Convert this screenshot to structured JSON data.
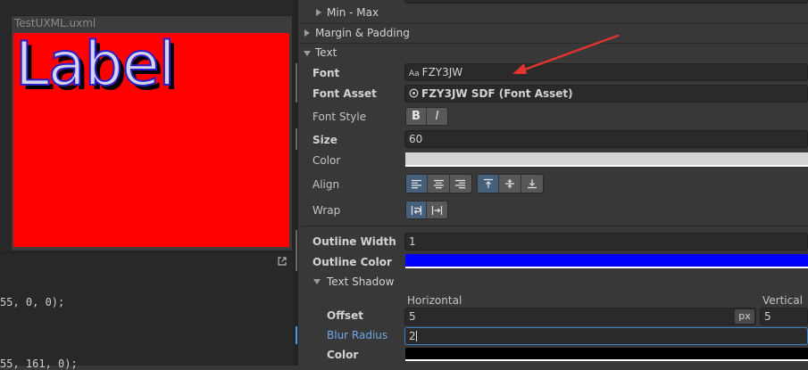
{
  "preview": {
    "title": "TestUXML.uxml",
    "label_text": "Label"
  },
  "code": {
    "line1": "55, 0, 0);",
    "line2": "55, 161, 0);"
  },
  "inspector": {
    "minmax_label": "Min - Max",
    "margin_padding_label": "Margin & Padding",
    "text_section_label": "Text",
    "font": {
      "label": "Font",
      "value": "FZY3JW",
      "icon": "font-asset-icon"
    },
    "font_asset": {
      "label": "Font Asset",
      "value": "FZY3JW SDF (Font Asset)",
      "icon": "sdf-font-icon"
    },
    "font_style": {
      "label": "Font Style",
      "bold": "B",
      "italic": "I"
    },
    "size": {
      "label": "Size",
      "value": "60"
    },
    "color": {
      "label": "Color",
      "value": "#d4d4d4"
    },
    "align": {
      "label": "Align",
      "selected_horizontal": "left",
      "selected_vertical": "top"
    },
    "wrap": {
      "label": "Wrap",
      "selected": "wrap"
    },
    "outline_width": {
      "label": "Outline Width",
      "value": "1"
    },
    "outline_color": {
      "label": "Outline Color",
      "value": "#0000ff"
    },
    "text_shadow": {
      "label": "Text Shadow",
      "horizontal_header": "Horizontal",
      "vertical_header": "Vertical",
      "offset_label": "Offset",
      "offset_x": "5",
      "offset_unit": "px",
      "offset_y": "5",
      "blur_label": "Blur Radius",
      "blur_value": "2",
      "color_label": "Color",
      "color_value": "#000000"
    }
  },
  "colors": {
    "annotation_arrow": "#e0332f",
    "accent_blue": "#4d9be8"
  }
}
